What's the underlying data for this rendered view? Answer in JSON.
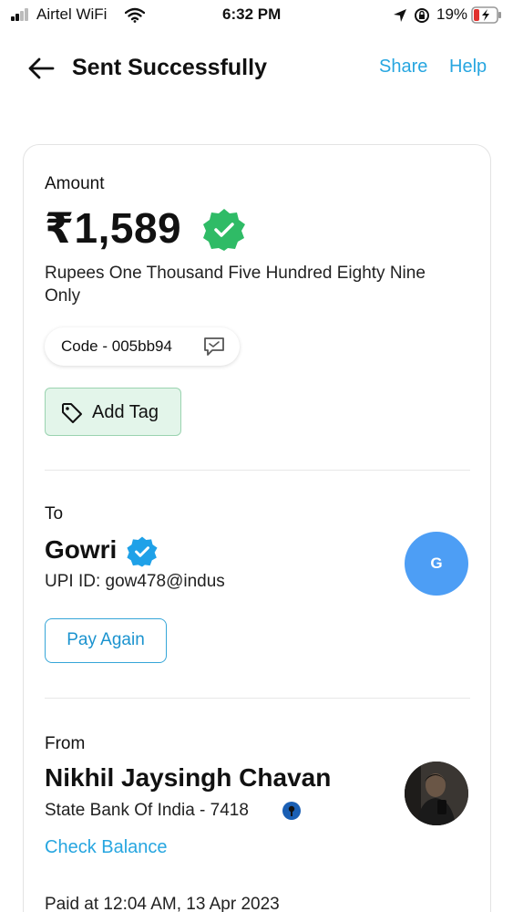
{
  "status_bar": {
    "carrier": "Airtel WiFi",
    "time": "6:32 PM",
    "battery": "19%"
  },
  "header": {
    "title": "Sent Successfully",
    "share": "Share",
    "help": "Help"
  },
  "amount_section": {
    "label": "Amount",
    "amount": "₹1,589",
    "amount_words": "Rupees One Thousand Five Hundred Eighty Nine Only",
    "code": "Code - 005bb94",
    "add_tag": "Add Tag"
  },
  "to_section": {
    "label": "To",
    "name": "Gowri",
    "upi_id": "UPI ID: gow478@indus",
    "avatar_initial": "G",
    "pay_again": "Pay Again"
  },
  "from_section": {
    "label": "From",
    "name": "Nikhil Jaysingh Chavan",
    "bank": "State Bank Of India - 7418",
    "check_balance": "Check Balance"
  },
  "paid_at": "Paid at 12:04 AM, 13 Apr 2023",
  "colors": {
    "accent": "#27a6e0",
    "verified_green": "#2fbb66",
    "verified_blue": "#1fa1e8",
    "tag_bg": "#e3f5ea",
    "avatar_bg": "#4d9ef5"
  },
  "icons": [
    "back-arrow-icon",
    "verified-badge-icon",
    "comment-icon",
    "tag-icon",
    "info-icon"
  ]
}
